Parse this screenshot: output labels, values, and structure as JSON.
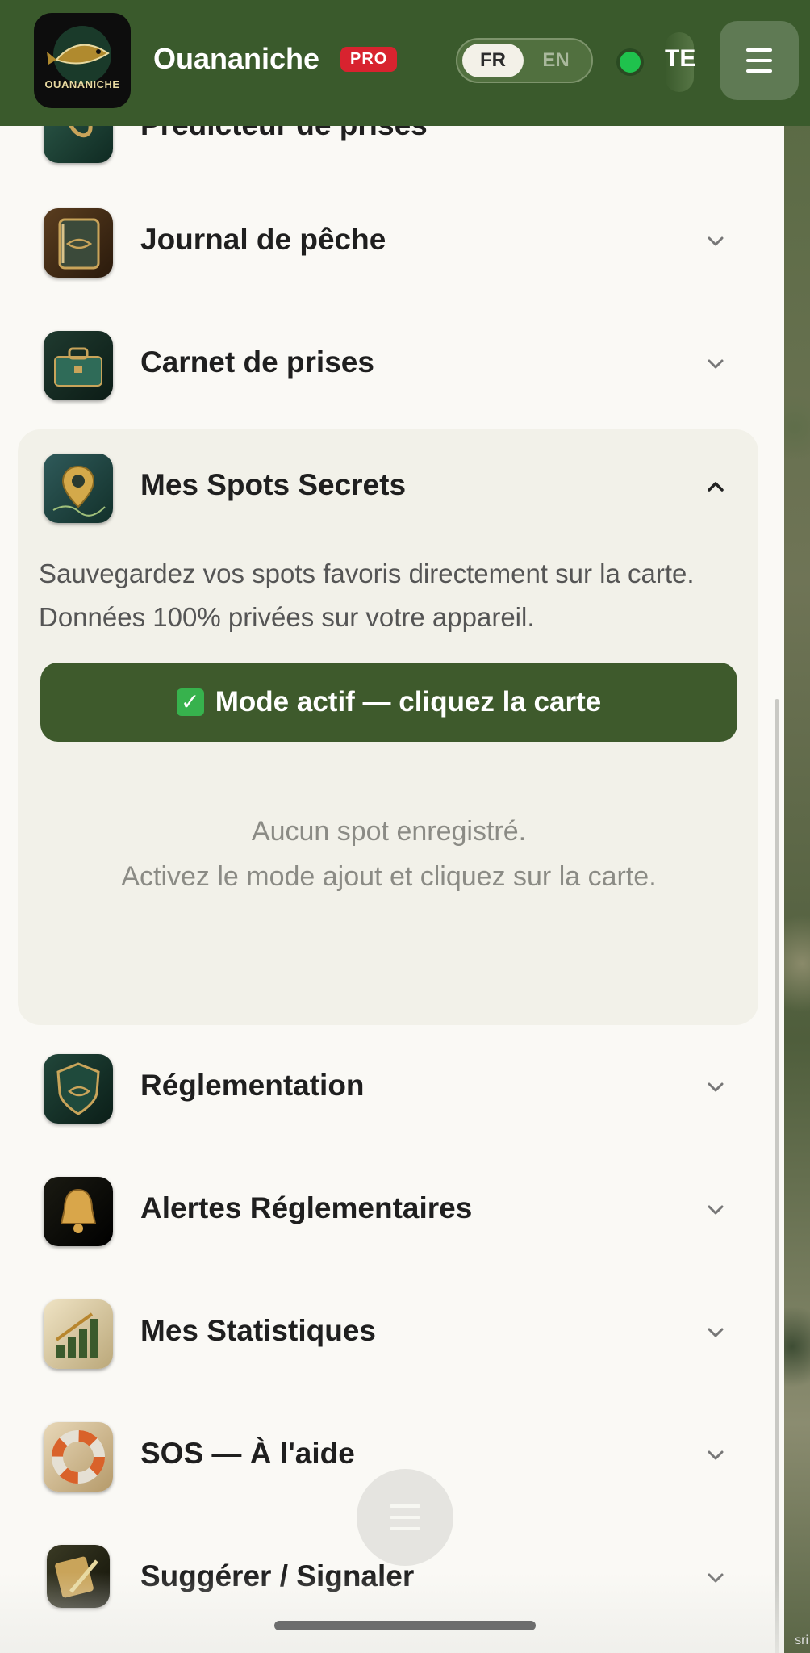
{
  "header": {
    "app_title": "Ouananiche",
    "pro_badge": "PRO",
    "logo_text": "OUANANICHE",
    "lang": {
      "fr": "FR",
      "en": "EN",
      "selected": "FR"
    },
    "status_label": "TE",
    "status_color": "#1fc24d"
  },
  "menu": {
    "items": [
      {
        "label": "Prédicteur de prises",
        "icon": "fishing-hook-icon",
        "expanded": false
      },
      {
        "label": "Journal de pêche",
        "icon": "journal-book-icon",
        "expanded": false
      },
      {
        "label": "Carnet de prises",
        "icon": "tackle-box-icon",
        "expanded": false
      },
      {
        "label": "Mes Spots Secrets",
        "icon": "map-pin-icon",
        "expanded": true
      },
      {
        "label": "Réglementation",
        "icon": "shield-fish-icon",
        "expanded": false
      },
      {
        "label": "Alertes Réglementaires",
        "icon": "bell-icon",
        "expanded": false
      },
      {
        "label": "Mes Statistiques",
        "icon": "bar-chart-icon",
        "expanded": false
      },
      {
        "label": "SOS — À l'aide",
        "icon": "lifebuoy-icon",
        "expanded": false
      },
      {
        "label": "Suggérer / Signaler",
        "icon": "pencil-paper-icon",
        "expanded": false
      }
    ]
  },
  "spots": {
    "description": "Sauvegardez vos spots favoris directement sur la carte. Données 100% privées sur votre appareil.",
    "mode_button": "Mode actif — cliquez la carte",
    "empty_line1": "Aucun spot enregistré.",
    "empty_line2": "Activez le mode ajout et cliquez sur la carte."
  },
  "map": {
    "attribution": "sri"
  },
  "colors": {
    "header_bg": "#3a5a2c",
    "accent_button": "#3e5a2c",
    "pro_badge": "#d8232f"
  }
}
